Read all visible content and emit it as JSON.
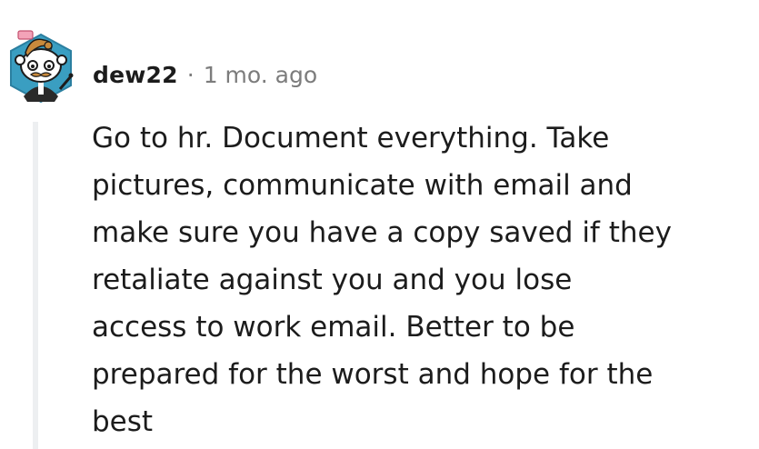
{
  "comment": {
    "username": "dew22",
    "separator": "·",
    "timestamp": "1 mo. ago",
    "avatar_icon": "snoo-avatar-icon",
    "body_lines": [
      "Go to hr. Document everything. Take",
      "pictures, communicate with email and",
      "make sure you have a copy saved if they",
      "retaliate against you and you lose",
      "access to work email. Better to be",
      "prepared for the worst and hope for the",
      "best"
    ]
  },
  "colors": {
    "text": "#1c1c1c",
    "meta": "#7c7c7c",
    "thread_line": "#edeff1",
    "avatar_bg": "#3a9ec1"
  }
}
